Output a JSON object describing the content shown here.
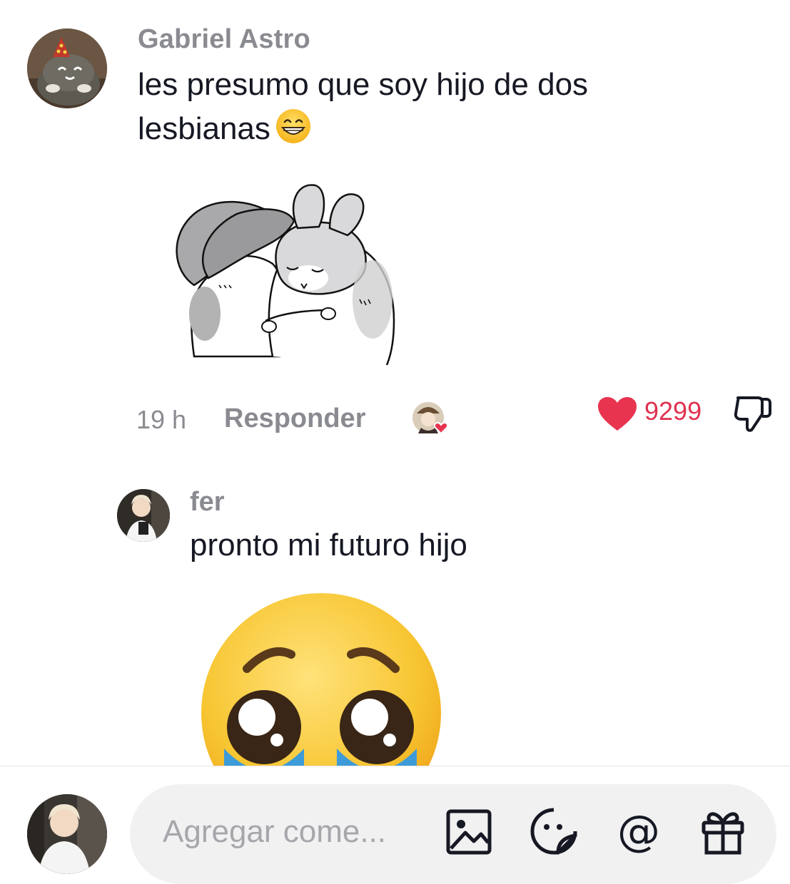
{
  "comment": {
    "author": "Gabriel Astro",
    "text_line1": "les presumo que soy hijo de dos",
    "text_line2": "lesbianas",
    "inline_emoji": "grinning-face-icon",
    "sticker": "hugging-bunnies-sticker",
    "time": "19 h",
    "reply_label": "Responder",
    "likes": "9299",
    "liked_by_creator": true
  },
  "reply": {
    "author": "fer",
    "text": "pronto mi futuro hijo",
    "sticker": "pleading-face-sticker"
  },
  "composer": {
    "placeholder": "Agregar come...",
    "tools": [
      "image-icon",
      "sticker-icon",
      "mention-icon",
      "gift-icon"
    ]
  },
  "colors": {
    "like_red": "#e8344f",
    "muted_text": "#8a8b91",
    "body_text": "#161823"
  }
}
